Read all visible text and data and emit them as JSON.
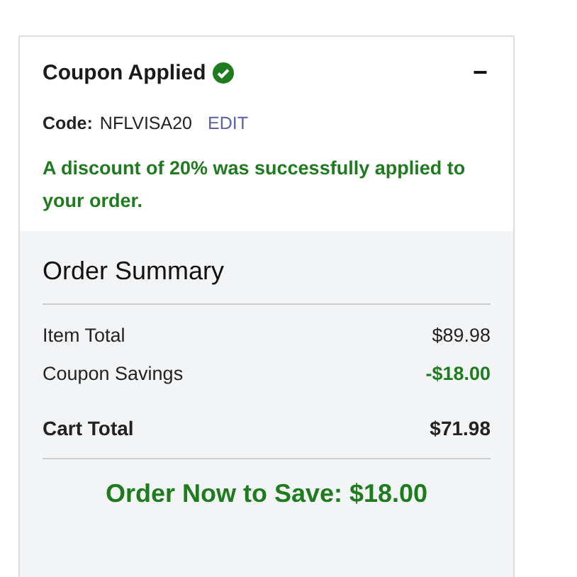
{
  "coupon": {
    "title": "Coupon Applied",
    "applied": true,
    "collapse_icon": "−",
    "code_label": "Code:",
    "code": "NFLVISA20",
    "edit_link": "EDIT",
    "message": "A discount of 20% was successfully applied to your order."
  },
  "summary": {
    "title": "Order Summary",
    "rows": [
      {
        "label": "Item Total",
        "value": "$89.98",
        "kind": "plain"
      },
      {
        "label": "Coupon Savings",
        "value": "-$18.00",
        "kind": "savings"
      }
    ],
    "total": {
      "label": "Cart Total",
      "value": "$71.98"
    },
    "cta": "Order Now to Save: $18.00"
  }
}
